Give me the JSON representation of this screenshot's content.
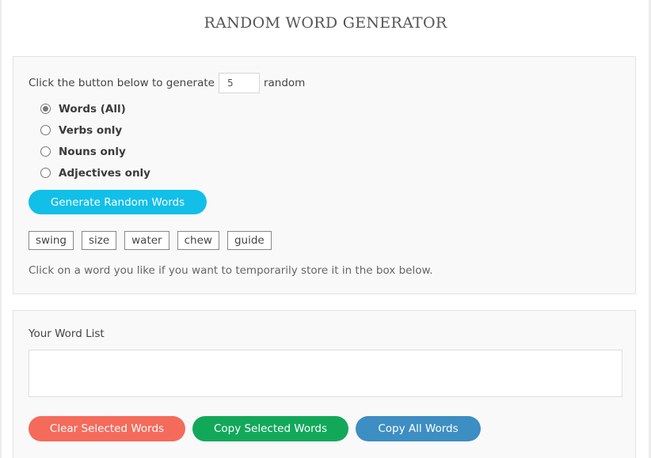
{
  "title": "RANDOM WORD GENERATOR",
  "generator": {
    "prompt_before": "Click the button below to generate",
    "count_value": "5",
    "prompt_after": "random",
    "options": [
      {
        "label": "Words (All)",
        "checked": true
      },
      {
        "label": "Verbs only",
        "checked": false
      },
      {
        "label": "Nouns only",
        "checked": false
      },
      {
        "label": "Adjectives only",
        "checked": false
      }
    ],
    "generate_label": "Generate Random Words",
    "words": [
      "swing",
      "size",
      "water",
      "chew",
      "guide"
    ],
    "hint": "Click on a word you like if you want to temporarily store it in the box below."
  },
  "word_list": {
    "label": "Your Word List",
    "value": "",
    "buttons": {
      "clear": "Clear Selected Words",
      "copy_selected": "Copy Selected Words",
      "copy_all": "Copy All Words"
    }
  },
  "colors": {
    "generate": "#12bfe9",
    "clear": "#f46b5b",
    "copy_selected": "#12a85a",
    "copy_all": "#3d8ec2"
  }
}
